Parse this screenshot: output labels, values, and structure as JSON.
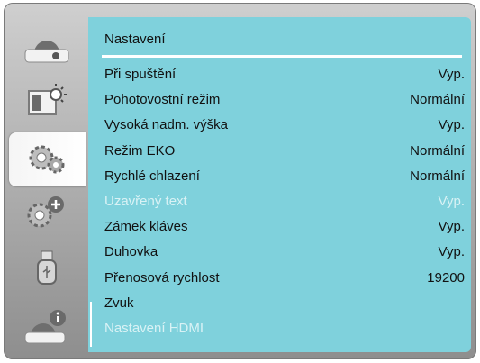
{
  "sidebar": {
    "items": [
      {
        "icon": "display-icon"
      },
      {
        "icon": "image-adjust-icon"
      },
      {
        "icon": "settings-gears-icon",
        "active": true
      },
      {
        "icon": "extended-settings-icon"
      },
      {
        "icon": "usb-icon"
      },
      {
        "icon": "info-icon"
      }
    ]
  },
  "menu": {
    "title": "Nastavení",
    "rows": [
      {
        "label": "Při spuštění",
        "value": "Vyp.",
        "enabled": true
      },
      {
        "label": "Pohotovostní režim",
        "value": "Normální",
        "enabled": true
      },
      {
        "label": "Vysoká nadm. výška",
        "value": "Vyp.",
        "enabled": true
      },
      {
        "label": "Režim EKO",
        "value": "Normální",
        "enabled": true
      },
      {
        "label": "Rychlé chlazení",
        "value": "Normální",
        "enabled": true
      },
      {
        "label": "Uzavřený text",
        "value": "Vyp.",
        "enabled": false
      },
      {
        "label": "Zámek kláves",
        "value": "Vyp.",
        "enabled": true
      },
      {
        "label": "Duhovka",
        "value": "Vyp.",
        "enabled": true
      },
      {
        "label": "Přenosová rychlost",
        "value": "19200",
        "enabled": true
      },
      {
        "label": "Zvuk",
        "value": "",
        "enabled": true
      },
      {
        "label": "Nastavení HDMI",
        "value": "",
        "enabled": false
      }
    ]
  },
  "colors": {
    "panel": "#7fd1dc",
    "text": "#111111",
    "disabled_text": "#d9f2f5",
    "frame": "#9e9e9e"
  }
}
